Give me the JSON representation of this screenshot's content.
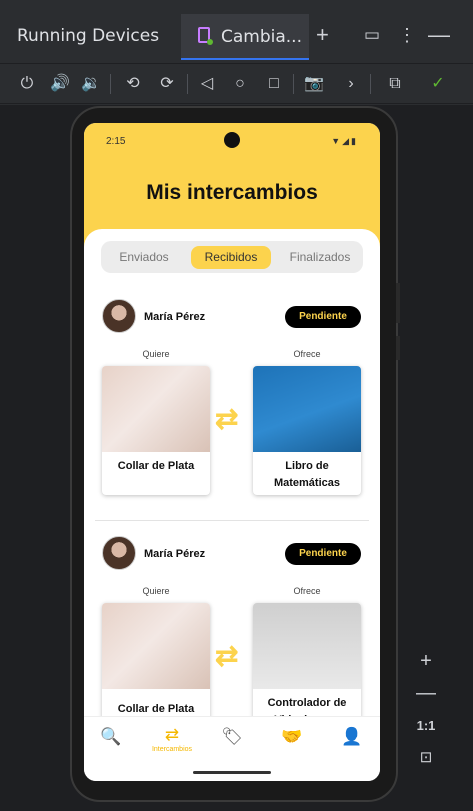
{
  "window": {
    "title": "Running Devices",
    "tab_label": "Cambia..."
  },
  "toolbar": {
    "icons": [
      "power-icon",
      "volume-up-icon",
      "volume-down-icon",
      "rotate-left-icon",
      "rotate-right-icon",
      "back-icon",
      "home-icon",
      "overview-icon",
      "screenshot-icon",
      "more-icon",
      "device-manager-icon",
      "check-icon"
    ]
  },
  "device": {
    "status_time": "2:15",
    "page_title": "Mis intercambios",
    "tabs": [
      {
        "label": "Enviados",
        "active": false
      },
      {
        "label": "Recibidos",
        "active": true
      },
      {
        "label": "Finalizados",
        "active": false
      }
    ],
    "trades": [
      {
        "user": "María Pérez",
        "status": "Pendiente",
        "wants_label": "Quiere",
        "offers_label": "Ofrece",
        "wants_item": "Collar de Plata",
        "offers_item": "Libro de Matemáticas"
      },
      {
        "user": "María Pérez",
        "status": "Pendiente",
        "wants_label": "Quiere",
        "offers_label": "Ofrece",
        "wants_item": "Collar de Plata",
        "offers_item": "Controlador de Videojuegos"
      }
    ],
    "nav": [
      {
        "icon": "search-icon",
        "label": ""
      },
      {
        "icon": "swap-icon",
        "label": "Intercambios",
        "active": true
      },
      {
        "icon": "tag-icon",
        "label": ""
      },
      {
        "icon": "handshake-icon",
        "label": ""
      },
      {
        "icon": "person-icon",
        "label": ""
      }
    ]
  },
  "zoom": {
    "reset_label": "1:1"
  },
  "colors": {
    "accent": "#fcd34d",
    "badge_bg": "#000000",
    "ide_bg": "#2b2d30"
  }
}
